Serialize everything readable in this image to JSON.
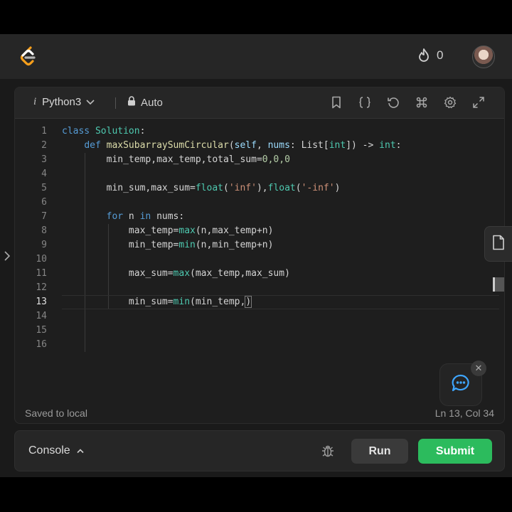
{
  "header": {
    "streak_count": "0",
    "icons": {
      "logo": "leetcode-logo",
      "streak": "flame-icon",
      "avatar": "user-avatar"
    }
  },
  "editor": {
    "language": "Python3",
    "language_info_glyph": "i",
    "mode": "Auto",
    "toolbar_icons": [
      "bookmark-icon",
      "braces-icon",
      "reset-icon",
      "command-icon",
      "settings-icon",
      "expand-icon"
    ],
    "status_saved": "Saved to local",
    "status_position": "Ln 13, Col 34",
    "current_line": 13,
    "lines": [
      {
        "n": "1"
      },
      {
        "n": "2"
      },
      {
        "n": "3"
      },
      {
        "n": "4"
      },
      {
        "n": "5"
      },
      {
        "n": "6"
      },
      {
        "n": "7"
      },
      {
        "n": "8"
      },
      {
        "n": "9"
      },
      {
        "n": "10"
      },
      {
        "n": "11"
      },
      {
        "n": "12"
      },
      {
        "n": "13"
      },
      {
        "n": "14"
      },
      {
        "n": "15"
      },
      {
        "n": "16"
      }
    ],
    "code": {
      "l1": {
        "kw": "class",
        "name": "Solution",
        "rest": ":"
      },
      "l2": {
        "kw": "def",
        "fn": "maxSubarraySumCircular",
        "p1": "(",
        "self": "self",
        "p2": ", ",
        "param": "nums",
        "p3": ": ",
        "list": "List",
        "p4": "[",
        "int1": "int",
        "p5": "]) -> ",
        "int2": "int",
        "p6": ":"
      },
      "l3": {
        "a": "min_temp,max_temp,total_sum=",
        "num": "0,0,0"
      },
      "l5": {
        "a": "min_sum,max_sum=",
        "f1": "float",
        "b": "(",
        "s1": "'inf'",
        "c": "),",
        "f2": "float",
        "d": "(",
        "s2": "'-inf'",
        "e": ")"
      },
      "l7": {
        "kw1": "for",
        "a": " n ",
        "kw2": "in",
        "b": " nums:"
      },
      "l8": {
        "a": "max_temp=",
        "bi": "max",
        "b": "(n,max_temp+n)"
      },
      "l9": {
        "a": "min_temp=",
        "bi": "min",
        "b": "(n,min_temp+n)"
      },
      "l11": {
        "a": "max_sum=",
        "bi": "max",
        "b": "(max_temp,max_sum)"
      },
      "l13": {
        "a": "min_sum=",
        "bi": "min",
        "b": "(min_temp,",
        "c": ")"
      }
    }
  },
  "console": {
    "label": "Console",
    "run_label": "Run",
    "submit_label": "Submit"
  },
  "colors": {
    "submit": "#2cbb5d",
    "background": "#1a1a1a",
    "panel": "#1e1e1e"
  }
}
